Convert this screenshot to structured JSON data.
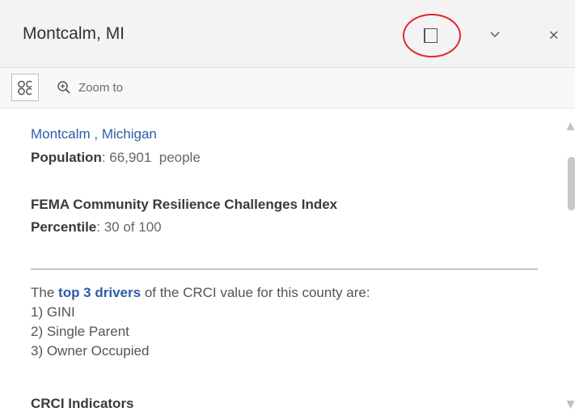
{
  "header": {
    "title": "Montcalm, MI"
  },
  "actions": {
    "zoom_label": "Zoom to"
  },
  "content": {
    "county_link": "Montcalm , Michigan",
    "population_label": "Population",
    "population_value": ": 66,901",
    "population_unit": "people",
    "index_title": "FEMA Community Resilience Challenges Index",
    "percentile_label": "Percentile",
    "percentile_value": ": 30 of 100",
    "drivers_prefix": "The",
    "drivers_link": "top 3 drivers",
    "drivers_suffix": "of the CRCI value for this county are:",
    "drivers": [
      "1) GINI",
      "2) Single Parent",
      "3) Owner Occupied"
    ],
    "section_heading": "CRCI Indicators"
  },
  "colors": {
    "link": "#2e5ca8",
    "highlight_ring": "#e3262b",
    "header_bg": "#f3f3f3"
  },
  "icons": {
    "dock": "dock-icon",
    "collapse": "chevron-down-icon",
    "close": "close-icon",
    "select": "select-feature-icon",
    "zoom": "zoom-in-icon"
  }
}
